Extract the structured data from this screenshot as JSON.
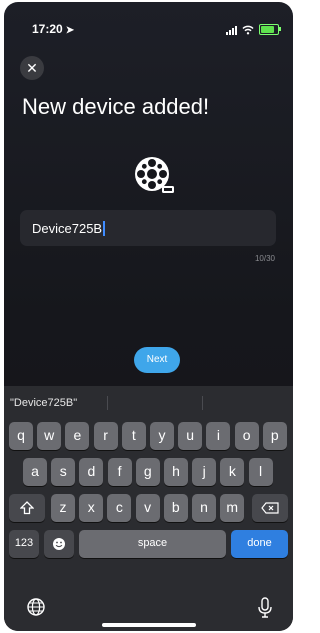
{
  "status_bar": {
    "time": "17:20",
    "location_icon": "location-arrow-icon",
    "signal_icon": "signal-icon",
    "wifi_icon": "wifi-icon",
    "battery_icon": "battery-charging-icon",
    "battery_level": 0.85
  },
  "header": {
    "close_icon": "close-icon",
    "title": "New device added!"
  },
  "device": {
    "logo_icon": "film-reel-camera-icon"
  },
  "name_input": {
    "value": "Device725B",
    "counter": "10/30"
  },
  "actions": {
    "next_label": "Next"
  },
  "keyboard": {
    "suggestion": "\"Device725B\"",
    "row1": [
      "q",
      "w",
      "e",
      "r",
      "t",
      "y",
      "u",
      "i",
      "o",
      "p"
    ],
    "row2": [
      "a",
      "s",
      "d",
      "f",
      "g",
      "h",
      "j",
      "k",
      "l"
    ],
    "row3": [
      "z",
      "x",
      "c",
      "v",
      "b",
      "n",
      "m"
    ],
    "shift_icon": "shift-icon",
    "delete_icon": "backspace-icon",
    "numbers_label": "123",
    "emoji_icon": "emoji-icon",
    "space_label": "space",
    "done_label": "done",
    "globe_icon": "globe-icon",
    "mic_icon": "microphone-icon"
  },
  "colors": {
    "accent": "#3fa6ea",
    "done_key": "#2f7fe0",
    "background": "#16171c"
  }
}
